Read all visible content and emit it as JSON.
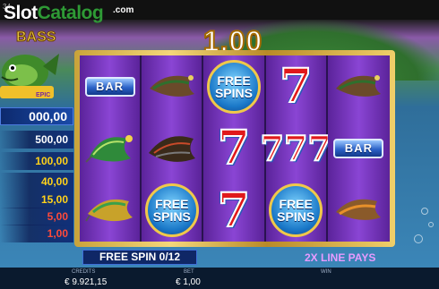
{
  "brand": {
    "slot": "Slot",
    "catalog": "Catalog",
    "dotcom": ".com"
  },
  "status_bar": {
    "time": "34"
  },
  "logo": {
    "text": "BASS",
    "sub": "EPIC"
  },
  "win_amount": "1,00",
  "paytable": [
    "000,00",
    "500,00",
    "100,00",
    "40,00",
    "15,00",
    "5,00",
    "1,00"
  ],
  "reels": [
    [
      "BAR",
      "fly-green",
      "fly-yellow"
    ],
    [
      "fly-brown",
      "fly-dark",
      "FREE SPINS"
    ],
    [
      "FREE SPINS",
      "seven",
      "seven"
    ],
    [
      "seven",
      "seven-stack",
      "FREE SPINS"
    ],
    [
      "fly-brown",
      "BAR",
      "fly-brown"
    ]
  ],
  "symbols": {
    "bar_label": "BAR",
    "free_line1": "FREE",
    "free_line2": "SPINS"
  },
  "free_spin_counter": "FREE SPIN 0/12",
  "line_pays": "2X LINE PAYS",
  "stats": {
    "credits_label": "CREDITS",
    "credits_value": "€ 9.921,15",
    "bet_label": "BET",
    "bet_value": "€ 1,00",
    "win_label": "WIN"
  },
  "colors": {
    "reel_bg": "#7a3cc4",
    "frame_gold": "#e8c45a",
    "win_text": "#ffffff",
    "ladder_yellow": "#ffd21a",
    "ladder_red": "#ff4a3a"
  }
}
